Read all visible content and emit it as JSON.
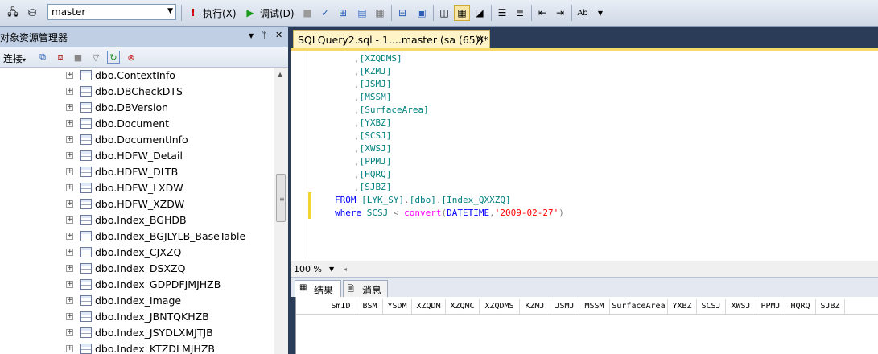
{
  "toolbar": {
    "database": "master",
    "execute_label": "执行(X)",
    "debug_label": "调试(D)"
  },
  "object_explorer": {
    "title": "对象资源管理器",
    "connect_label": "连接",
    "items": [
      "dbo.ContextInfo",
      "dbo.DBCheckDTS",
      "dbo.DBVersion",
      "dbo.Document",
      "dbo.DocumentInfo",
      "dbo.HDFW_Detail",
      "dbo.HDFW_DLTB",
      "dbo.HDFW_LXDW",
      "dbo.HDFW_XZDW",
      "dbo.Index_BGHDB",
      "dbo.Index_BGJLYLB_BaseTable",
      "dbo.Index_CJXZQ",
      "dbo.Index_DSXZQ",
      "dbo.Index_GDPDFJMJHZB",
      "dbo.Index_Image",
      "dbo.Index_JBNTQKHZB",
      "dbo.Index_JSYDLXMJTJB",
      "dbo.Index_KTZDLMJHZB"
    ]
  },
  "editor": {
    "tab_title": "SQLQuery2.sql - 1....master (sa (65))*",
    "columns": [
      "[XZQDMS]",
      "[KZMJ]",
      "[JSMJ]",
      "[MSSM]",
      "[SurfaceArea]",
      "[YXBZ]",
      "[SCSJ]",
      "[XWSJ]",
      "[PPMJ]",
      "[HQRQ]",
      "[SJBZ]"
    ],
    "from_line": {
      "keyword": "FROM",
      "schema": "[LYK_SY]",
      "dot1": ".",
      "owner": "[dbo]",
      "dot2": ".",
      "table": "[Index_QXXZQ]"
    },
    "where_line": {
      "keyword": "where",
      "column": "SCSJ",
      "op": "<",
      "func": "convert",
      "open": "(",
      "type": "DATETIME",
      "comma": ",",
      "literal": "'2009-02-27'",
      "close": ")"
    },
    "zoom": "100 %"
  },
  "results": {
    "tab_results": "结果",
    "tab_messages": "消息",
    "headers": [
      "SmID",
      "BSM",
      "YSDM",
      "XZQDM",
      "XZQMC",
      "XZQDMS",
      "KZMJ",
      "JSMJ",
      "MSSM",
      "SurfaceArea",
      "YXBZ",
      "SCSJ",
      "XWSJ",
      "PPMJ",
      "HQRQ",
      "SJBZ"
    ]
  },
  "colors": {
    "keyword": "#0000ff",
    "identifier": "#008080",
    "function": "#ff00ff",
    "string": "#ff0000",
    "operator": "#808080"
  }
}
